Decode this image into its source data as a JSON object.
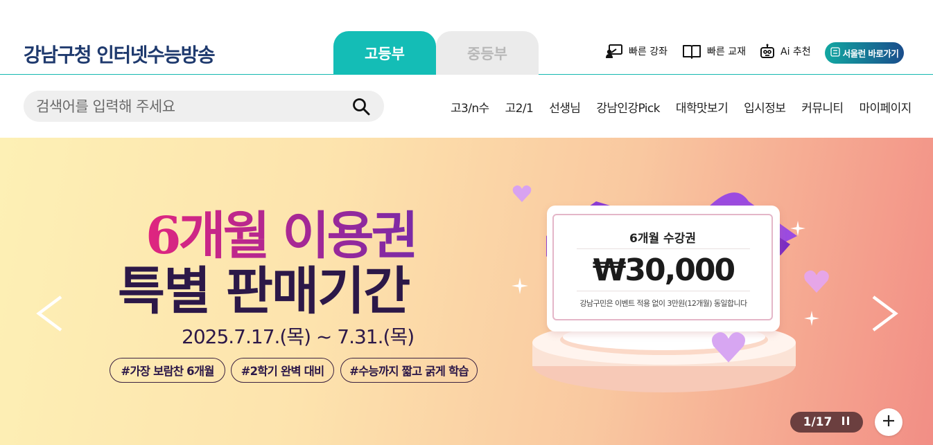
{
  "header": {
    "logo": "강남구청 인터넷수능방송",
    "tabs": [
      {
        "label": "고등부",
        "active": true
      },
      {
        "label": "중등부",
        "active": false
      }
    ],
    "utilities": [
      {
        "label": "빠른 강좌",
        "icon": "lecture-board-icon"
      },
      {
        "label": "빠른 교재",
        "icon": "book-icon"
      },
      {
        "label": "Ai 추천",
        "icon": "robot-icon"
      }
    ],
    "seoul_button": "서울런 바로가기"
  },
  "search": {
    "placeholder": "검색어를 입력해 주세요",
    "value": ""
  },
  "nav": [
    "고3/n수",
    "고2/1",
    "선생님",
    "강남인강Pick",
    "대학맛보기",
    "입시정보",
    "커뮤니티",
    "마이페이지"
  ],
  "banner": {
    "title_line1": "6개월 이용권",
    "title_line2": "특별 판매기간",
    "date": "2025.7.17.(목) ~ 7.31.(목)",
    "hashtags": [
      "#가장 보람찬 6개월",
      "#2학기 완벽 대비",
      "#수능까지 짧고 굵게 학습"
    ],
    "ticket": {
      "name": "6개월 수강권",
      "price": "₩30,000",
      "note": "강남구민은 이벤트 적용 없이 3만원(12개월) 동일합니다"
    },
    "pagination": {
      "text": "1/17",
      "current": 1,
      "total": 17
    },
    "colors": {
      "accent": "#14bdb6",
      "title_pink": "#e0257f",
      "title_purple": "#7a2aa6",
      "dark": "#2c1848"
    }
  }
}
